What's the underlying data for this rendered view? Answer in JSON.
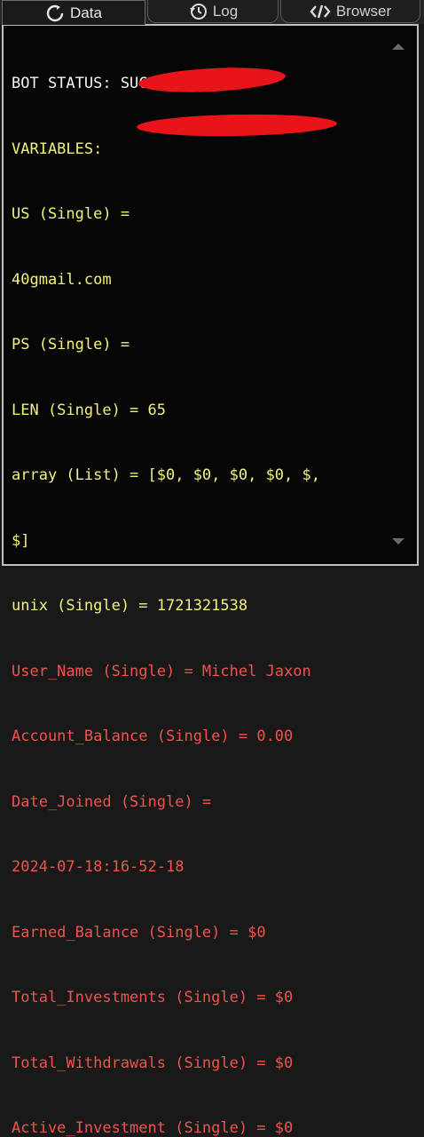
{
  "tabs": [
    {
      "label": "Data",
      "icon": "refresh-icon",
      "active": true
    },
    {
      "label": "Log",
      "icon": "history-icon",
      "active": false
    },
    {
      "label": "Browser",
      "icon": "code-icon",
      "active": false
    }
  ],
  "console": {
    "status": "BOT STATUS: SUCCESS",
    "variables_header": "VARIABLES:",
    "us_prefix": "US (Single) =",
    "us_tail": "40gmail.com",
    "ps_prefix": "PS (Single) =",
    "len": "LEN (Single) = 65",
    "array_line1": "array (List) = [$0, $0, $0, $0, $,",
    "array_line2": "$]",
    "unix": "unix (Single) = 1721321538",
    "user_name": "User_Name (Single) = Michel Jaxon",
    "account_balance": "Account_Balance (Single) = 0.00",
    "date_joined_line1": "Date_Joined (Single) =",
    "date_joined_line2": "2024-07-18:16-52-18",
    "earned_balance": "Earned_Balance (Single) = $0",
    "total_investments": "Total_Investments (Single) = $0",
    "total_withdrawals": "Total_Withdrawals (Single) = $0",
    "active_investment": "Active_Investment (Single) = $0"
  },
  "colors": {
    "status": "#f4f4f4",
    "variables": "#f2f27a",
    "captured": "#f0534c",
    "redaction": "#e8141a"
  }
}
